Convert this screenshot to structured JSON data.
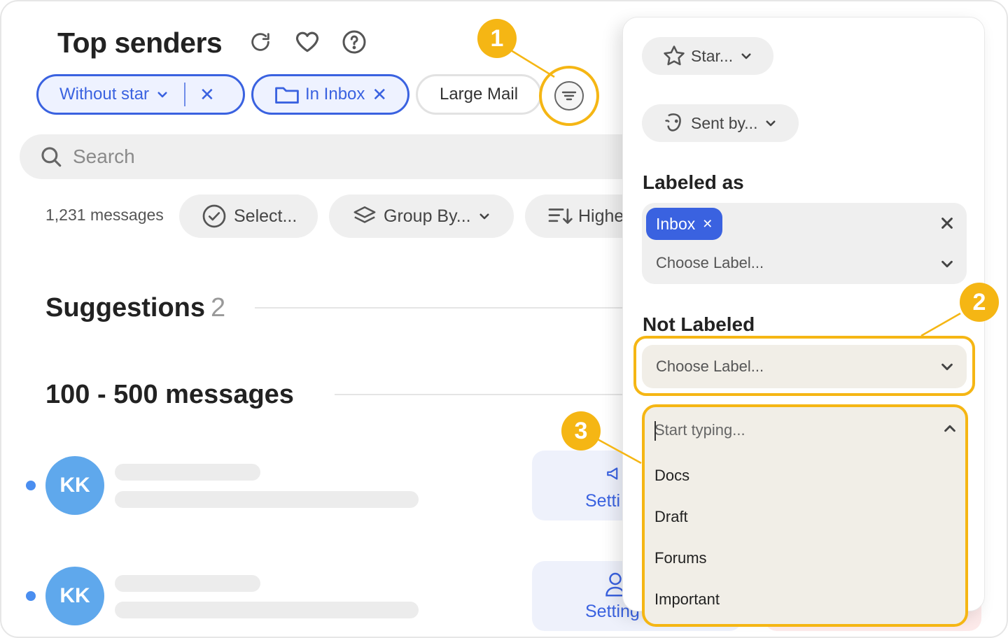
{
  "header": {
    "title": "Top senders",
    "icons": [
      "refresh-icon",
      "heart-icon",
      "help-icon"
    ]
  },
  "filters": {
    "without_star": "Without star",
    "in_inbox": "In Inbox",
    "large_mail": "Large Mail",
    "remove_glyph": "✕"
  },
  "search": {
    "placeholder": "Search"
  },
  "toolbar": {
    "count": "1,231 messages",
    "select": "Select...",
    "group_by": "Group By...",
    "sort": "Highe"
  },
  "sections": {
    "suggestions": "Suggestions",
    "suggestions_count": "2",
    "range": "100 - 500 messages"
  },
  "rows": [
    {
      "initials": "KK",
      "action": "Setti"
    },
    {
      "initials": "KK",
      "action": "Setting"
    }
  ],
  "panel": {
    "star": "Star...",
    "sent_by": "Sent by...",
    "labeled_as": "Labeled as",
    "inbox_tag": "Inbox",
    "choose_label": "Choose Label...",
    "not_labeled": "Not Labeled",
    "not_choose": "Choose Label...",
    "dropdown_placeholder": "Start typing...",
    "options": [
      "Docs",
      "Draft",
      "Forums",
      "Important"
    ]
  },
  "callouts": [
    "1",
    "2",
    "3"
  ],
  "colors": {
    "accent": "#3a62e0",
    "highlight": "#f5b614",
    "avatar": "#5fa8ec"
  }
}
